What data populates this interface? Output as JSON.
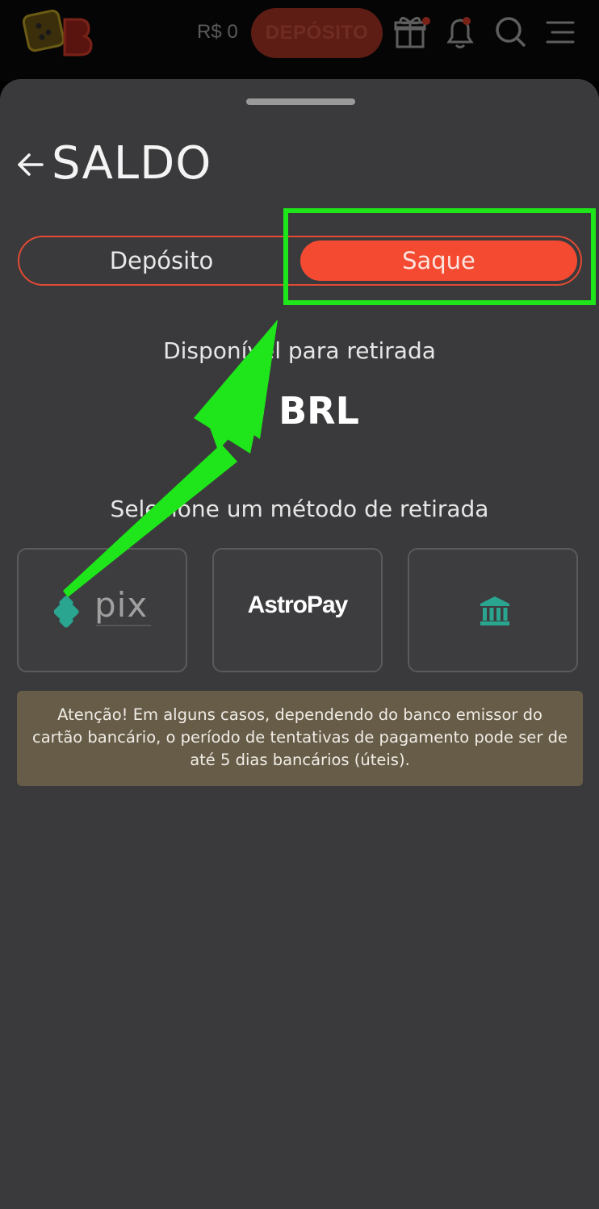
{
  "header": {
    "balance": "R$ 0",
    "deposit_label": "DEPÓSITO"
  },
  "sheet": {
    "title": "SALDO",
    "tabs": [
      {
        "label": "Depósito",
        "active": false
      },
      {
        "label": "Saque",
        "active": true
      }
    ],
    "available_label": "Disponível para retirada",
    "available_amount": "0 BRL",
    "method_prompt": "Selecione um método de retirada",
    "methods": [
      {
        "name": "pix",
        "label": "pix",
        "icon": "pix-icon"
      },
      {
        "name": "astropay",
        "label": "AstroPay",
        "icon": "astropay-logo"
      },
      {
        "name": "bank",
        "icon": "bank-icon"
      }
    ],
    "notice": "Atenção! Em alguns casos, dependendo do banco emissor do cartão bancário, o período de tentativas de pagamento pode ser de até 5 dias bancários (úteis)."
  },
  "colors": {
    "accent": "#f44a32",
    "highlight": "#1ee61a",
    "teal": "#2aa58f",
    "notice_bg": "#675c48",
    "sheet_bg": "#3a3a3c"
  }
}
